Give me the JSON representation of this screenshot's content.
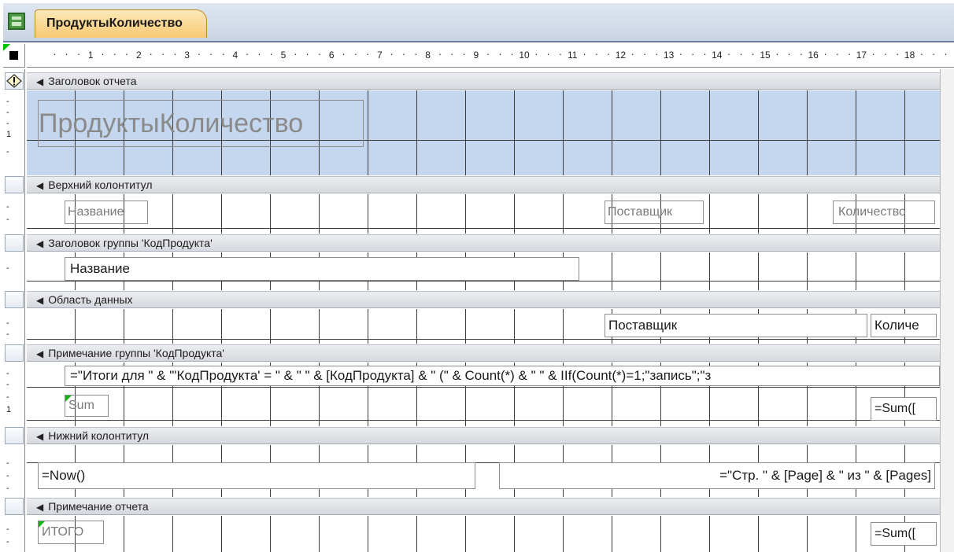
{
  "tab": {
    "title": "ПродуктыКоличество",
    "icon": "report-icon"
  },
  "ruler": {
    "marks": [
      "1",
      "2",
      "3",
      "4",
      "5",
      "6",
      "7",
      "8",
      "9",
      "10",
      "11",
      "12",
      "13",
      "14",
      "15",
      "16",
      "17",
      "18"
    ]
  },
  "vertical_ruler": {
    "marks": [
      "1",
      "1"
    ]
  },
  "sections": {
    "report_header": {
      "title": "Заголовок отчета"
    },
    "page_header": {
      "title": "Верхний колонтитул"
    },
    "group_header": {
      "title": "Заголовок группы 'КодПродукта'"
    },
    "detail": {
      "title": "Область данных"
    },
    "group_footer": {
      "title": "Примечание группы 'КодПродукта'"
    },
    "page_footer": {
      "title": "Нижний колонтитул"
    },
    "report_footer": {
      "title": "Примечание отчета"
    }
  },
  "controls": {
    "report_title": "ПродуктыКоличество",
    "ph_name_label": "Название",
    "ph_supplier_label": "Поставщик",
    "ph_quantity_label": "Количество",
    "gh_name_field": "Название",
    "detail_supplier_field": "Поставщик",
    "detail_quantity_field": "Количе",
    "gf_summary_expr": "=\"Итоги для \" & \"'КодПродукта' = \" & \" \" & [КодПродукта] & \" (\" & Count(*) & \" \" & IIf(Count(*)=1;\"запись\";\"з",
    "gf_sum_label": "Sum",
    "gf_sum_field": "=Sum([",
    "pf_now_field": "=Now()",
    "pf_pages_field": "=\"Стр. \" & [Page] & \" из \" & [Pages]",
    "rf_total_label": "ИТОГО",
    "rf_sum_field": "=Sum(["
  },
  "colors": {
    "header_band": "#c5d7ee",
    "tab": "#f8c873",
    "grid": "#3d3d3d"
  }
}
